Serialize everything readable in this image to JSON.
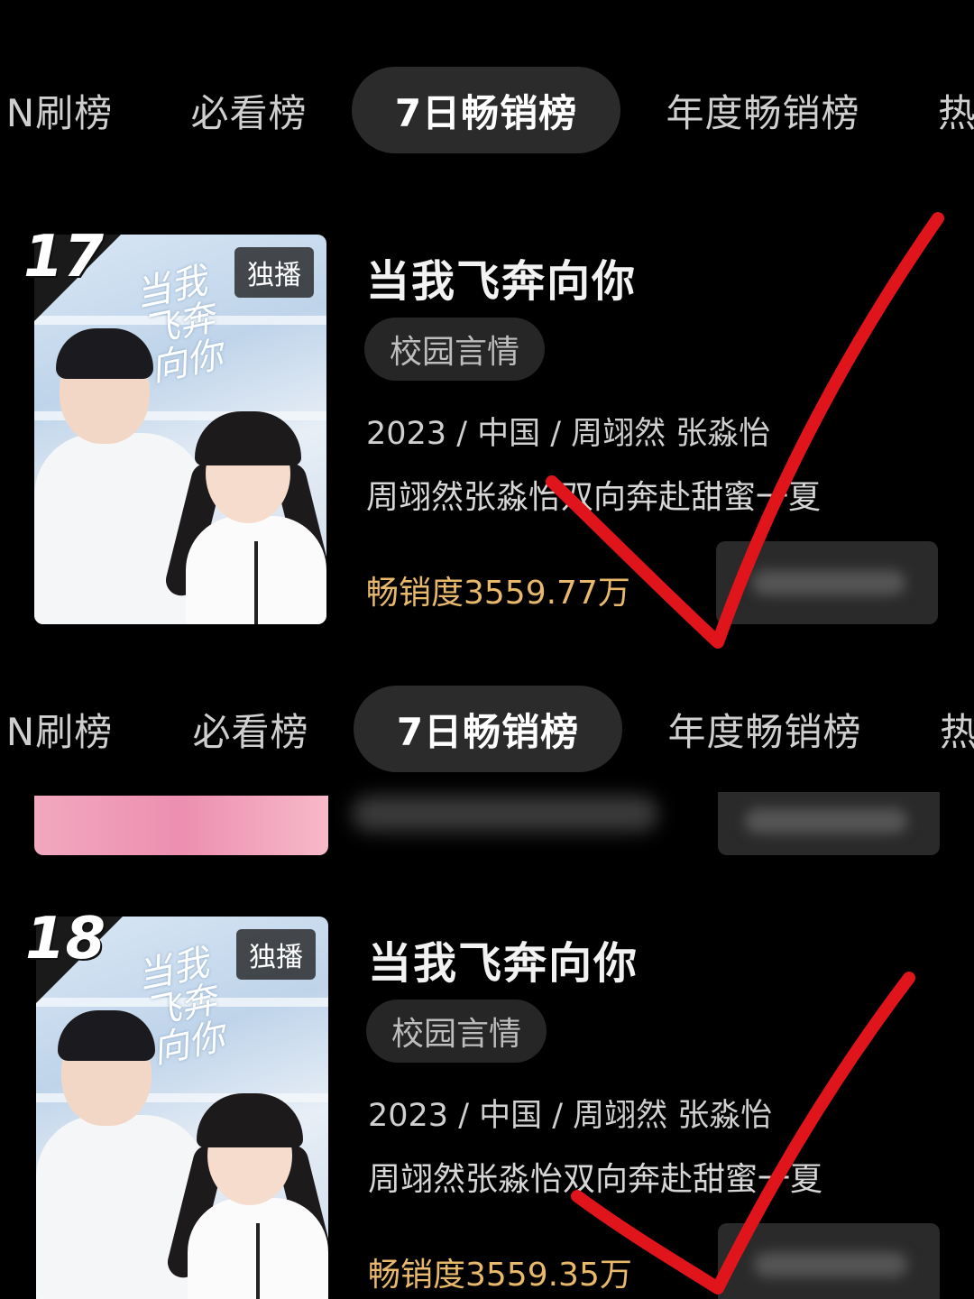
{
  "top_tabs": {
    "items": [
      {
        "label": "N刷榜"
      },
      {
        "label": "必看榜"
      },
      {
        "label": "7日畅销榜",
        "active": true
      },
      {
        "label": "年度畅销榜"
      },
      {
        "label": "热"
      }
    ]
  },
  "second_tabs": {
    "items": [
      {
        "label": "N刷榜"
      },
      {
        "label": "必看榜"
      },
      {
        "label": "7日畅销榜",
        "active": true
      },
      {
        "label": "年度畅销榜"
      },
      {
        "label": "热"
      }
    ]
  },
  "cards": [
    {
      "rank": "17",
      "badge": "独播",
      "poster_calligraphy": "当我飞奔向你",
      "title": "当我飞奔向你",
      "genre": "校园言情",
      "meta": "2023 / 中国 / 周翊然 张淼怡",
      "description": "周翊然张淼怡双向奔赴甜蜜一夏",
      "sales": "畅销度3559.77万"
    },
    {
      "rank": "18",
      "badge": "独播",
      "poster_calligraphy": "当我飞奔向你",
      "title": "当我飞奔向你",
      "genre": "校园言情",
      "meta": "2023 / 中国 / 周翊然 张淼怡",
      "description": "周翊然张淼怡双向奔赴甜蜜一夏",
      "sales": "畅销度3559.35万"
    }
  ],
  "colors": {
    "background": "#000000",
    "active_tab_bg": "#2b2b2b",
    "sales_text": "#e9b96b",
    "check_mark": "#e0151b"
  }
}
